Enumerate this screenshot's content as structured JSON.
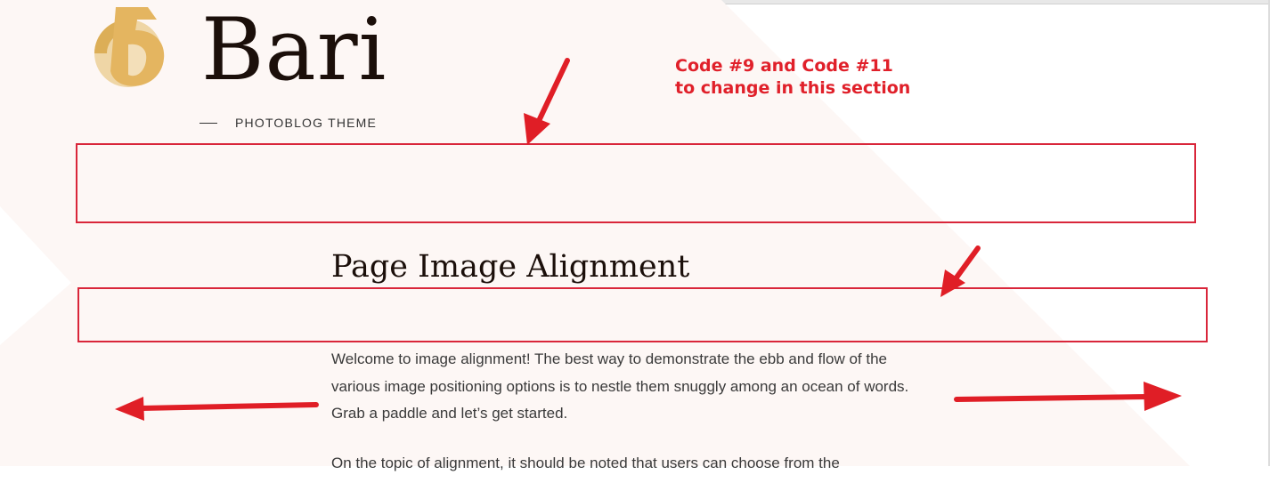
{
  "site": {
    "title": "Bari",
    "tagline": "PHOTOBLOG THEME"
  },
  "annotation": {
    "line1": "Code #9 and Code #11",
    "line2": "to change in this section",
    "color": "#e0202a"
  },
  "page": {
    "title": "Page Image Alignment",
    "paragraphs": [
      "Welcome to image alignment! The best way to demonstrate the ebb and flow of the various image positioning options is to nestle them snuggly among an ocean of words. Grab a paddle and let’s get started.",
      "On the topic of alignment, it should be noted that users can choose from the"
    ]
  },
  "colors": {
    "accent_red": "#d9263a",
    "background_tint": "#fdf7f5",
    "logo_gold": "#e2b866",
    "text_dark": "#1b0f0a"
  },
  "icons": {
    "logo": "bari-b-logo-icon"
  }
}
